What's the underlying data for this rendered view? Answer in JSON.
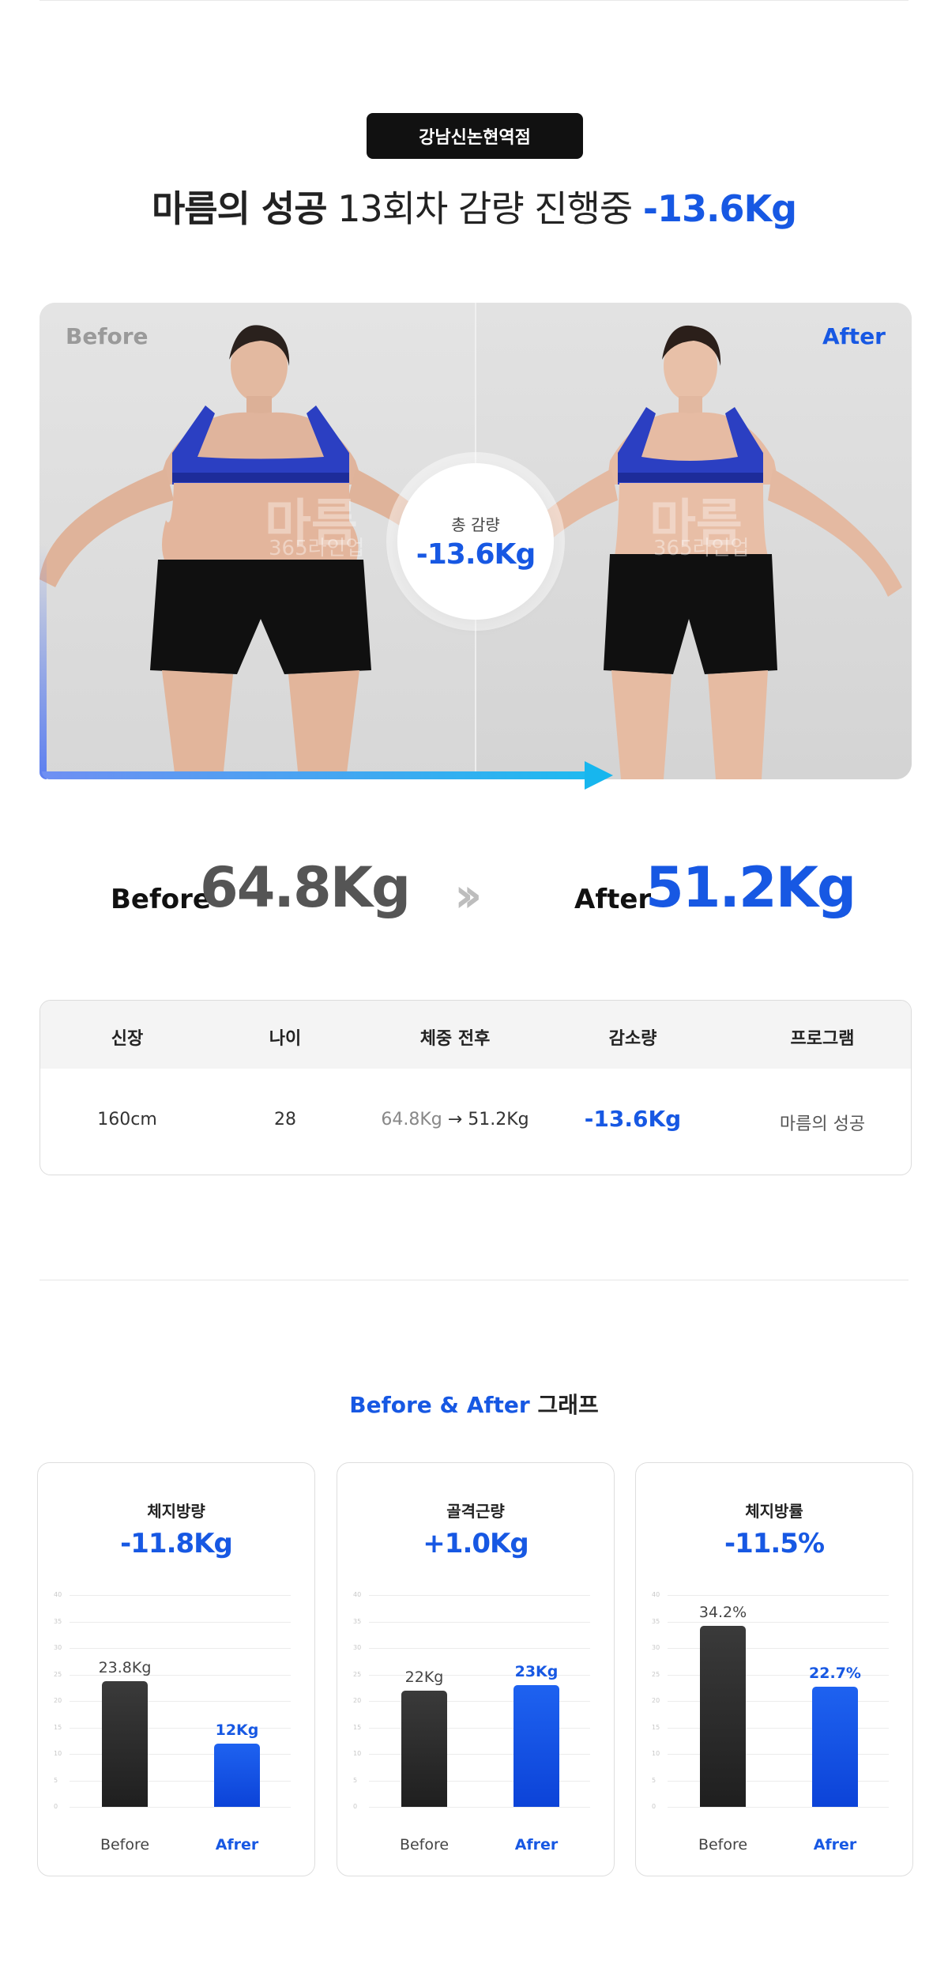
{
  "branch_badge": "강남신논현역점",
  "headline": {
    "program": "마름의 성공",
    "session": "13회차 감량 진행중",
    "loss": "-13.6Kg"
  },
  "photos": {
    "before_label": "Before",
    "after_label": "After",
    "total_label": "총 감량",
    "total_value": "-13.6Kg",
    "watermark": "마름",
    "watermark_sub": "365라인업"
  },
  "weights": {
    "before_label": "Before",
    "before_value": "64.8Kg",
    "separator_icon": "double-chevron-right-icon",
    "after_label": "After",
    "after_value": "51.2Kg"
  },
  "info_table": {
    "headers": [
      "신장",
      "나이",
      "체중 전후",
      "감소량",
      "프로그램"
    ],
    "height": "160cm",
    "age": "28",
    "weight_before": "64.8Kg",
    "arrow": "→",
    "weight_after": "51.2Kg",
    "reduction": "-13.6Kg",
    "program": "마름의 성공"
  },
  "graph_section": {
    "title_blue": "Before & After",
    "title_dark": "그래프"
  },
  "colors": {
    "accent": "#1758e3",
    "badge_bg": "#111111",
    "before_bar": "#2b2b2b",
    "after_bar": "#1554e6"
  },
  "chart_data": [
    {
      "type": "bar",
      "title": "체지방량",
      "change": "-11.8Kg",
      "categories": [
        "Before",
        "Afrer"
      ],
      "values": [
        23.8,
        12
      ],
      "value_labels": [
        "23.8Kg",
        "12Kg"
      ],
      "ylim": [
        0,
        40
      ],
      "yticks": [
        0,
        5,
        10,
        15,
        20,
        25,
        30,
        35,
        40
      ],
      "grid": true
    },
    {
      "type": "bar",
      "title": "골격근량",
      "change": "+1.0Kg",
      "categories": [
        "Before",
        "Afrer"
      ],
      "values": [
        22,
        23
      ],
      "value_labels": [
        "22Kg",
        "23Kg"
      ],
      "ylim": [
        0,
        40
      ],
      "yticks": [
        0,
        5,
        10,
        15,
        20,
        25,
        30,
        35,
        40
      ],
      "grid": true
    },
    {
      "type": "bar",
      "title": "체지방률",
      "change": "-11.5%",
      "categories": [
        "Before",
        "Afrer"
      ],
      "values": [
        34.2,
        22.7
      ],
      "value_labels": [
        "34.2%",
        "22.7%"
      ],
      "ylim": [
        0,
        40
      ],
      "yticks": [
        0,
        5,
        10,
        15,
        20,
        25,
        30,
        35,
        40
      ],
      "grid": true
    }
  ]
}
